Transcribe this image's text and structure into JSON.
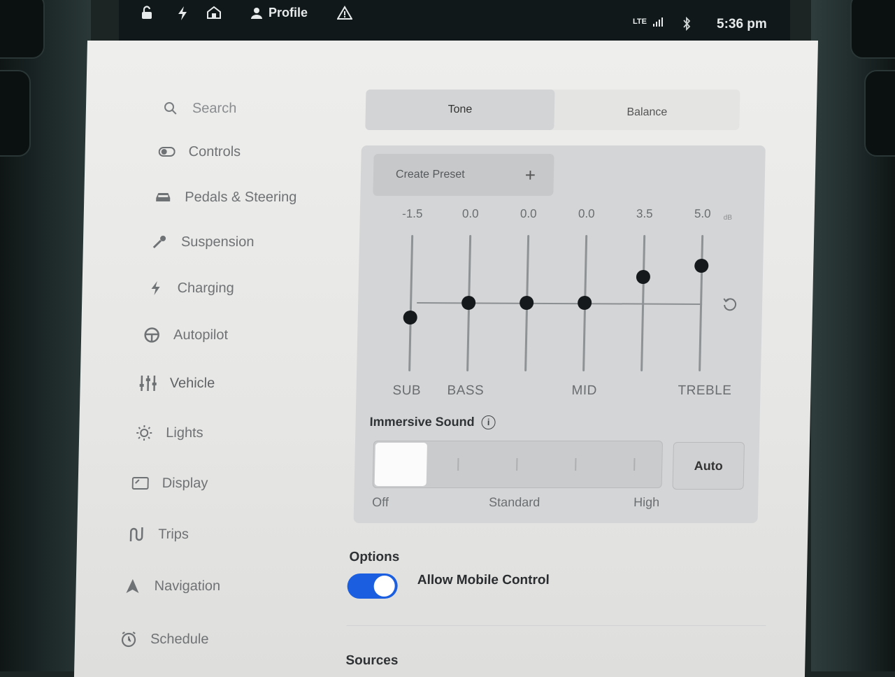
{
  "status_bar": {
    "profile_label": "Profile",
    "lte_label": "LTE",
    "time": "5:36 pm"
  },
  "menu": {
    "items": [
      {
        "label": "Search",
        "icon": "search-icon"
      },
      {
        "label": "Controls",
        "icon": "toggle-icon"
      },
      {
        "label": "Pedals & Steering",
        "icon": "car-icon"
      },
      {
        "label": "Suspension",
        "icon": "wrench-icon"
      },
      {
        "label": "Charging",
        "icon": "bolt-icon"
      },
      {
        "label": "Autopilot",
        "icon": "steering-wheel-icon"
      },
      {
        "label": "Vehicle",
        "icon": "sliders-icon"
      },
      {
        "label": "Lights",
        "icon": "light-icon"
      },
      {
        "label": "Display",
        "icon": "display-icon"
      },
      {
        "label": "Trips",
        "icon": "trips-icon"
      },
      {
        "label": "Navigation",
        "icon": "navigation-arrow-icon"
      },
      {
        "label": "Schedule",
        "icon": "alarm-clock-icon"
      }
    ]
  },
  "tabs": [
    {
      "label": "Tone",
      "active": true
    },
    {
      "label": "Balance",
      "active": false
    }
  ],
  "equalizer": {
    "create_preset_label": "Create Preset",
    "unit": "dB",
    "bands": [
      {
        "value": "-1.5",
        "label": "SUB"
      },
      {
        "value": "0.0",
        "label": "BASS"
      },
      {
        "value": "0.0",
        "label": ""
      },
      {
        "value": "0.0",
        "label": "MID"
      },
      {
        "value": "3.5",
        "label": ""
      },
      {
        "value": "5.0",
        "label": "TREBLE"
      }
    ]
  },
  "immersive_sound": {
    "title": "Immersive Sound",
    "info_glyph": "i",
    "labels": {
      "off": "Off",
      "standard": "Standard",
      "high": "High"
    },
    "auto_label": "Auto",
    "selected": "Off"
  },
  "options": {
    "title": "Options",
    "allow_mobile_control_label": "Allow Mobile Control",
    "allow_mobile_control_on": true
  },
  "sources_title": "Sources",
  "colors": {
    "toggle_on": "#1b5fe0",
    "knob": "#15191c"
  }
}
